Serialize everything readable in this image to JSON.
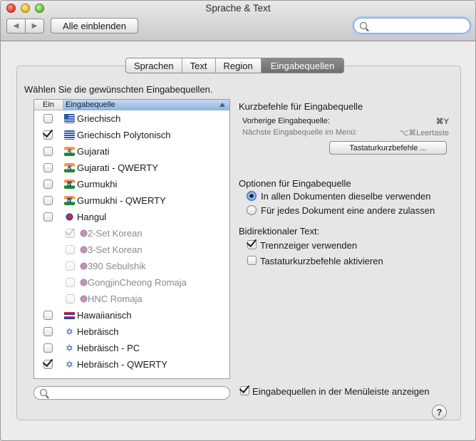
{
  "window": {
    "title": "Sprache & Text"
  },
  "toolbar": {
    "back_label": "◀",
    "forward_label": "▶",
    "show_all_label": "Alle einblenden",
    "search_placeholder": ""
  },
  "tabs": [
    {
      "label": "Sprachen",
      "active": false
    },
    {
      "label": "Text",
      "active": false
    },
    {
      "label": "Region",
      "active": false
    },
    {
      "label": "Eingabequellen",
      "active": true
    }
  ],
  "instruction": "Wählen Sie die gewünschten Eingabequellen.",
  "list": {
    "col_on": "Ein",
    "col_source": "Eingabequelle",
    "rows": [
      {
        "label": "Griechisch",
        "checked": false,
        "dim": false,
        "icon": "greek-flag-icon"
      },
      {
        "label": "Griechisch Polytonisch",
        "checked": true,
        "dim": false,
        "icon": "greek-polytonic-flag-icon"
      },
      {
        "label": "Gujarati",
        "checked": false,
        "dim": false,
        "icon": "gujarati-icon"
      },
      {
        "label": "Gujarati - QWERTY",
        "checked": false,
        "dim": false,
        "icon": "gujarati-qwerty-icon"
      },
      {
        "label": "Gurmukhi",
        "checked": false,
        "dim": false,
        "icon": "gurmukhi-icon"
      },
      {
        "label": "Gurmukhi - QWERTY",
        "checked": false,
        "dim": false,
        "icon": "gurmukhi-qwerty-icon"
      },
      {
        "label": "Hangul",
        "checked": false,
        "dim": false,
        "icon": "korea-flag-icon"
      },
      {
        "label": "2-Set Korean",
        "checked": true,
        "dim": true,
        "icon": "korea-2set-icon"
      },
      {
        "label": "3-Set Korean",
        "checked": false,
        "dim": true,
        "icon": "korea-3set-icon"
      },
      {
        "label": "390 Sebulshik",
        "checked": false,
        "dim": true,
        "icon": "korea-390-icon"
      },
      {
        "label": "GongjinCheong Romaja",
        "checked": false,
        "dim": true,
        "icon": "korea-romaja-icon"
      },
      {
        "label": "HNC Romaja",
        "checked": false,
        "dim": true,
        "icon": "korea-hnc-icon"
      },
      {
        "label": "Hawaiianisch",
        "checked": false,
        "dim": false,
        "icon": "hawaii-flag-icon"
      },
      {
        "label": "Hebräisch",
        "checked": false,
        "dim": false,
        "icon": "hebrew-star-icon"
      },
      {
        "label": "Hebräisch - PC",
        "checked": false,
        "dim": false,
        "icon": "hebrew-pc-icon"
      },
      {
        "label": "Hebräisch - QWERTY",
        "checked": true,
        "dim": false,
        "icon": "hebrew-qwerty-icon"
      }
    ]
  },
  "shortcuts": {
    "heading": "Kurzbefehle für Eingabequelle",
    "prev_label": "Vorherige Eingabequelle:",
    "prev_key": "⌘Y",
    "next_label": "Nächste Eingabequelle im Menü:",
    "next_key": "⌥⌘Leertaste",
    "button": "Tastaturkurzbefehle ..."
  },
  "options": {
    "heading": "Optionen für Eingabequelle",
    "radio_same": "In allen Dokumenten dieselbe verwenden",
    "radio_diff": "Für jedes Dokument eine andere zulassen",
    "selected": "same"
  },
  "bidi": {
    "heading": "Bidirektionaler Text:",
    "cursor_label": "Trennzeiger verwenden",
    "cursor_checked": true,
    "keys_label": "Tastaturkurzbefehle aktivieren",
    "keys_checked": false
  },
  "footer": {
    "menu_label": "Eingabequellen in der Menüleiste anzeigen",
    "menu_checked": true,
    "filter_placeholder": "",
    "help_label": "?"
  }
}
